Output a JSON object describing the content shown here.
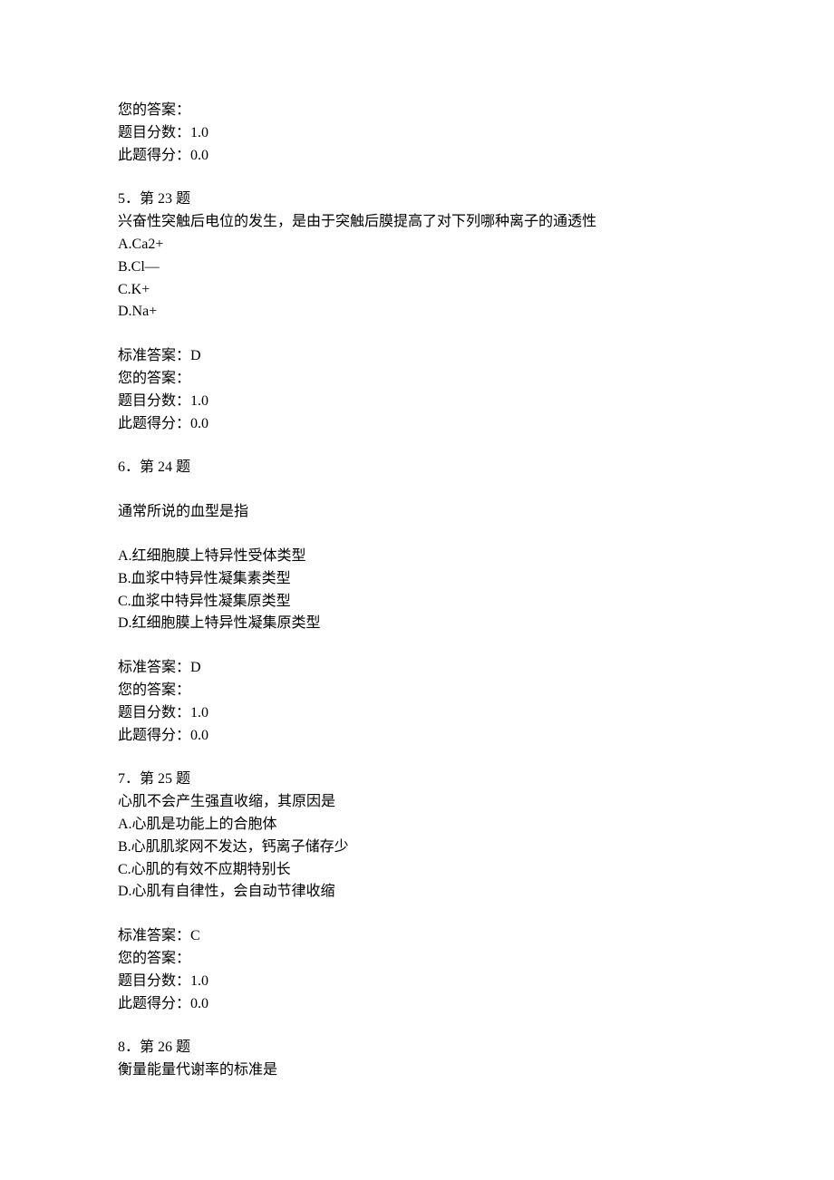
{
  "intro": {
    "your_answer_label": "您的答案：",
    "your_answer_value": "",
    "score_label": "题目分数：",
    "score_value": "1.0",
    "earned_label": "此题得分：",
    "earned_value": "0.0"
  },
  "questions": [
    {
      "index": "5．",
      "title": "第 23 题",
      "stem": "兴奋性突触后电位的发生，是由于突触后膜提高了对下列哪种离子的通透性",
      "options": [
        "A.Ca2+",
        "B.Cl—",
        "C.K+",
        "D.Na+"
      ],
      "std_label": "标准答案：",
      "std_value": "D",
      "your_label": "您的答案：",
      "your_value": "",
      "score_label": "题目分数：",
      "score_value": "1.0",
      "earned_label": "此题得分：",
      "earned_value": "0.0"
    },
    {
      "index": "6．",
      "title": "第 24 题",
      "stem": "通常所说的血型是指",
      "options": [
        "A.红细胞膜上特异性受体类型",
        "B.血浆中特异性凝集素类型",
        "C.血浆中特异性凝集原类型",
        "D.红细胞膜上特异性凝集原类型"
      ],
      "std_label": "标准答案：",
      "std_value": "D",
      "your_label": "您的答案：",
      "your_value": "",
      "score_label": "题目分数：",
      "score_value": "1.0",
      "earned_label": "此题得分：",
      "earned_value": "0.0",
      "stem_gap": true
    },
    {
      "index": "7．",
      "title": "第 25 题",
      "stem": "心肌不会产生强直收缩，其原因是",
      "options": [
        "A.心肌是功能上的合胞体",
        "B.心肌肌浆网不发达，钙离子储存少",
        "C.心肌的有效不应期特别长",
        "D.心肌有自律性，会自动节律收缩"
      ],
      "std_label": "标准答案：",
      "std_value": "C",
      "your_label": "您的答案：",
      "your_value": "",
      "score_label": "题目分数：",
      "score_value": "1.0",
      "earned_label": "此题得分：",
      "earned_value": "0.0"
    },
    {
      "index": "8．",
      "title": "第 26 题",
      "stem": "衡量能量代谢率的标准是",
      "options": [],
      "std_label": "",
      "std_value": "",
      "your_label": "",
      "your_value": "",
      "score_label": "",
      "score_value": "",
      "earned_label": "",
      "earned_value": "",
      "tail": true
    }
  ]
}
